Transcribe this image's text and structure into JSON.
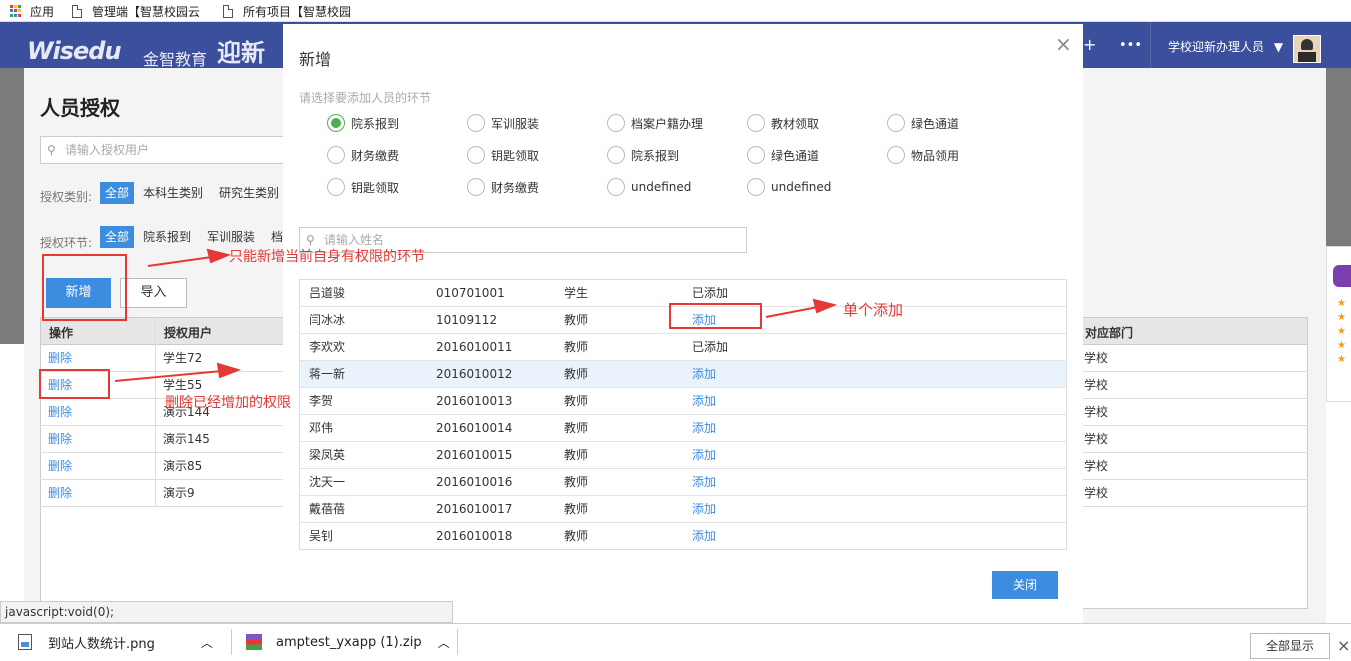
{
  "bookmarks": {
    "apps": "应用",
    "item1": "管理端【智慧校园云",
    "item2": "所有项目【智慧校园"
  },
  "header": {
    "logo": "Wisedu",
    "logo_cn": "金智教育",
    "logo_app": "迎新",
    "more": "•••",
    "user": "学校迎新办理人员",
    "dropdown": "▼",
    "extra": "+"
  },
  "page": {
    "title": "人员授权",
    "search_placeholder": "请输入授权用户",
    "category_label": "授权类别:",
    "categories": [
      "全部",
      "本科生类别",
      "研究生类别"
    ],
    "stage_label": "授权环节:",
    "stages": [
      "全部",
      "院系报到",
      "军训服装",
      "档"
    ],
    "new_button": "新增",
    "import_button": "导入",
    "table": {
      "headers": [
        "操作",
        "授权用户",
        "对应部门"
      ],
      "rows": [
        {
          "op": "删除",
          "user": "学生72",
          "dept": "学校"
        },
        {
          "op": "删除",
          "user": "学生55",
          "dept": "学校"
        },
        {
          "op": "删除",
          "user": "演示144",
          "dept": "学校"
        },
        {
          "op": "删除",
          "user": "演示145",
          "dept": "学校"
        },
        {
          "op": "删除",
          "user": "演示85",
          "dept": "学校"
        },
        {
          "op": "删除",
          "user": "演示9",
          "dept": "学校"
        }
      ]
    }
  },
  "modal": {
    "title": "新增",
    "close_icon": "×",
    "hint": "请选择要添加人员的环节",
    "options": [
      {
        "label": "院系报到",
        "checked": true
      },
      {
        "label": "军训服装",
        "checked": false
      },
      {
        "label": "档案户籍办理",
        "checked": false
      },
      {
        "label": "教材领取",
        "checked": false
      },
      {
        "label": "绿色通道",
        "checked": false
      },
      {
        "label": "财务缴费",
        "checked": false
      },
      {
        "label": "钥匙领取",
        "checked": false
      },
      {
        "label": "院系报到",
        "checked": false
      },
      {
        "label": "绿色通道",
        "checked": false
      },
      {
        "label": "物品领用",
        "checked": false
      },
      {
        "label": "钥匙领取",
        "checked": false
      },
      {
        "label": "财务缴费",
        "checked": false
      },
      {
        "label": "undefined",
        "checked": false
      },
      {
        "label": "undefined",
        "checked": false
      }
    ],
    "search_placeholder": "请输入姓名",
    "rows": [
      {
        "name": "吕道骏",
        "id": "010701001",
        "role": "学生",
        "action": "已添加",
        "added": true
      },
      {
        "name": "闫冰冰",
        "id": "10109112",
        "role": "教师",
        "action": "添加",
        "added": false
      },
      {
        "name": "李欢欢",
        "id": "2016010011",
        "role": "教师",
        "action": "已添加",
        "added": true
      },
      {
        "name": "蒋一新",
        "id": "2016010012",
        "role": "教师",
        "action": "添加",
        "added": false
      },
      {
        "name": "李贺",
        "id": "2016010013",
        "role": "教师",
        "action": "添加",
        "added": false
      },
      {
        "name": "邓伟",
        "id": "2016010014",
        "role": "教师",
        "action": "添加",
        "added": false
      },
      {
        "name": "梁凤英",
        "id": "2016010015",
        "role": "教师",
        "action": "添加",
        "added": false
      },
      {
        "name": "沈天一",
        "id": "2016010016",
        "role": "教师",
        "action": "添加",
        "added": false
      },
      {
        "name": "戴蓓蓓",
        "id": "2016010017",
        "role": "教师",
        "action": "添加",
        "added": false
      },
      {
        "name": "吴钊",
        "id": "2016010018",
        "role": "教师",
        "action": "添加",
        "added": false
      }
    ],
    "close_button": "关闭"
  },
  "annotations": {
    "a1": "只能新增当前自身有权限的环节",
    "a2": "删除已经增加的权限",
    "a3": "单个添加"
  },
  "statusbar": "javascript:void(0);",
  "downloads": {
    "file1": "到站人数统计.png",
    "file2": "amptest_yxapp (1).zip",
    "show_all": "全部显示"
  },
  "colors": {
    "header": "#3c4f9c",
    "primary": "#3c8de0",
    "annotation": "#e53935",
    "radio_checked": "#4caf50"
  }
}
